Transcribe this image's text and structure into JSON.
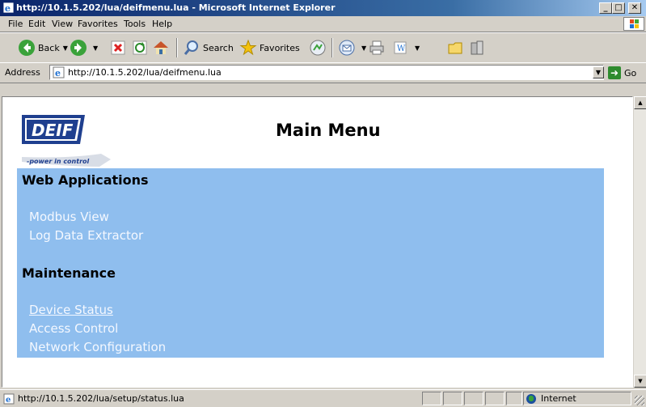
{
  "window": {
    "title": "http://10.1.5.202/lua/deifmenu.lua - Microsoft Internet Explorer",
    "minimize_glyph": "_",
    "maximize_glyph": "□",
    "close_glyph": "✕"
  },
  "menubar": {
    "items": [
      {
        "label": "File",
        "accel": "F"
      },
      {
        "label": "Edit",
        "accel": "E"
      },
      {
        "label": "View",
        "accel": "V"
      },
      {
        "label": "Favorites",
        "accel": "a"
      },
      {
        "label": "Tools",
        "accel": "T"
      },
      {
        "label": "Help",
        "accel": "H"
      }
    ]
  },
  "toolbar": {
    "back_label": "Back",
    "search_label": "Search",
    "favorites_label": "Favorites"
  },
  "address": {
    "label": "Address",
    "url": "http://10.1.5.202/lua/deifmenu.lua",
    "go_label": "Go"
  },
  "page": {
    "logo_text": "DEIF",
    "logo_tagline": "-power in control",
    "title": "Main Menu",
    "sections": [
      {
        "title": "Web Applications",
        "links": [
          {
            "label": "Modbus View",
            "active": false
          },
          {
            "label": "Log Data Extractor",
            "active": false
          }
        ]
      },
      {
        "title": "Maintenance",
        "links": [
          {
            "label": "Device Status",
            "active": true
          },
          {
            "label": "Access Control",
            "active": false
          },
          {
            "label": "Network Configuration",
            "active": false
          }
        ]
      }
    ],
    "panel_color": "#8fbeee",
    "link_color": "#f4f8ff"
  },
  "statusbar": {
    "text": "http://10.1.5.202/lua/setup/status.lua",
    "zone": "Internet"
  },
  "icons": {
    "ie": "ie-logo-icon",
    "back": "back-arrow-icon",
    "forward": "forward-arrow-icon",
    "stop": "stop-icon",
    "refresh": "refresh-icon",
    "home": "home-icon",
    "search": "search-icon",
    "favorites": "star-icon",
    "media": "media-icon",
    "mail": "mail-icon",
    "print": "print-icon",
    "edit": "edit-icon",
    "folder": "folder-icon",
    "research": "research-icon"
  }
}
